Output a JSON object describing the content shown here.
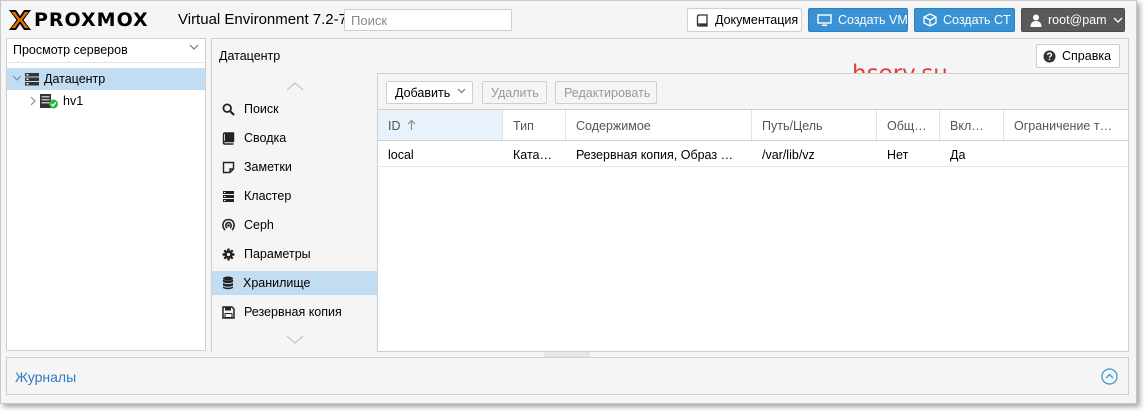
{
  "header": {
    "logo_text": "PROXMOX",
    "version": "Virtual Environment 7.2-7",
    "search_placeholder": "Поиск",
    "docs_label": "Документация",
    "create_vm_label": "Создать VM",
    "create_ct_label": "Создать CT",
    "user_label": "root@pam"
  },
  "tree": {
    "view_label": "Просмотр серверов",
    "datacenter_label": "Датацентр",
    "node_label": "hv1"
  },
  "content": {
    "title": "Датацентр",
    "help_label": "Справка",
    "watermark": "hserv.su"
  },
  "nav": {
    "items": [
      {
        "label": "Поиск",
        "icon": "search-icon"
      },
      {
        "label": "Сводка",
        "icon": "book-icon"
      },
      {
        "label": "Заметки",
        "icon": "note-icon"
      },
      {
        "label": "Кластер",
        "icon": "server-icon"
      },
      {
        "label": "Ceph",
        "icon": "ceph-icon"
      },
      {
        "label": "Параметры",
        "icon": "gear-icon"
      },
      {
        "label": "Хранилище",
        "icon": "database-icon"
      },
      {
        "label": "Резервная копия",
        "icon": "floppy-icon"
      }
    ],
    "active_index": 6
  },
  "toolbar": {
    "add_label": "Добавить",
    "delete_label": "Удалить",
    "edit_label": "Редактировать"
  },
  "grid": {
    "columns": [
      "ID",
      "Тип",
      "Содержимое",
      "Путь/Цель",
      "Общ…",
      "Вкл…",
      "Ограничение т…"
    ],
    "rows": [
      [
        "local",
        "Ката…",
        "Резервная копия, Образ …",
        "/var/lib/vz",
        "Нет",
        "Да",
        ""
      ]
    ]
  },
  "log": {
    "title": "Журналы"
  },
  "colors": {
    "accent": "#3892d4",
    "selection": "#c2ddf2",
    "user_button": "#5a5a5a",
    "logo_orange": "#e57000",
    "watermark": "#e33b3b",
    "status_ok": "#2fb344"
  }
}
